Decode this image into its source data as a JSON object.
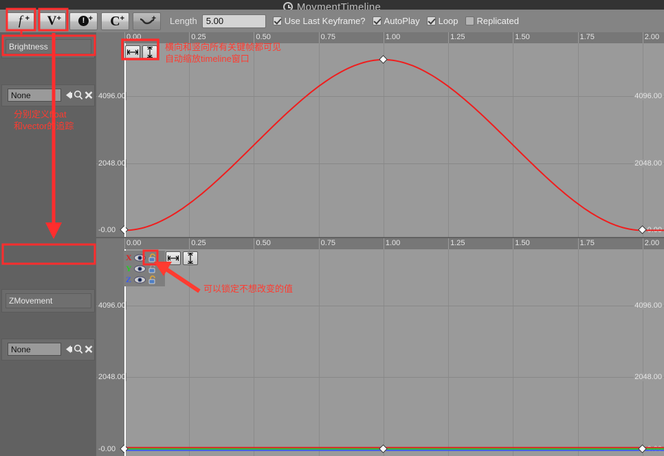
{
  "window": {
    "title": "MovmentTimeline",
    "icon": "clock-icon"
  },
  "toolbar": {
    "buttons": [
      {
        "name": "add-float-track",
        "glyph": "f",
        "plus": "+"
      },
      {
        "name": "add-vector-track",
        "glyph": "V",
        "plus": "+"
      },
      {
        "name": "add-event-track",
        "glyph": "!",
        "plus": "+"
      },
      {
        "name": "add-color-track",
        "glyph": "C",
        "plus": "+"
      },
      {
        "name": "add-curve-asset-track",
        "glyph": "curve",
        "plus": "+"
      }
    ],
    "length_label": "Length",
    "length_value": "5.00",
    "checkboxes": [
      {
        "label": "Use Last Keyframe?",
        "checked": true
      },
      {
        "label": "AutoPlay",
        "checked": true
      },
      {
        "label": "Loop",
        "checked": true
      },
      {
        "label": "Replicated",
        "checked": false
      }
    ]
  },
  "tracks": [
    {
      "name": "Brightness",
      "asset_value": "None",
      "asset_placeholder": "None",
      "type": "float",
      "curve_color": "#f01d1d"
    },
    {
      "name": "ZMovement",
      "asset_value": "None",
      "asset_placeholder": "None",
      "type": "vector",
      "axes": [
        {
          "label": "X",
          "color": "#e02020",
          "visible": true,
          "locked": false
        },
        {
          "label": "Y",
          "color": "#28c828",
          "visible": true,
          "locked": false
        },
        {
          "label": "Z",
          "color": "#3a5cf0",
          "visible": true,
          "locked": false
        }
      ]
    }
  ],
  "zoom_buttons": {
    "horizontal_label": "[↔]",
    "vertical_label": "↕",
    "horizontal_name": "zoom-to-fit-horizontal",
    "vertical_name": "zoom-to-fit-vertical"
  },
  "annotations": [
    {
      "id": "anno-toolbar",
      "text": "分别定义float\n和vector的追踪"
    },
    {
      "id": "anno-zoomfit",
      "text": "横向和竖向所有关键帧都可见\n自动缩放timeline窗口"
    },
    {
      "id": "anno-lock",
      "text": "可以锁定不想改变的值"
    }
  ],
  "chart_data": [
    {
      "type": "line",
      "name": "Brightness",
      "title": "Brightness",
      "xlabel": "",
      "ylabel": "",
      "xlim": [
        0.0,
        2.083
      ],
      "ylim": [
        -200,
        5700
      ],
      "xticks": [
        "0.00",
        "0.25",
        "0.50",
        "0.75",
        "1.00",
        "1.25",
        "1.50",
        "1.75",
        "2.00"
      ],
      "xtick_values": [
        0.0,
        0.25,
        0.5,
        0.75,
        1.0,
        1.25,
        1.5,
        1.75,
        2.0
      ],
      "yticks": [
        "4096.00",
        "2048.00",
        "-0.00"
      ],
      "ytick_values": [
        4096,
        2048,
        0
      ],
      "grid": true,
      "series": [
        {
          "name": "Brightness",
          "color": "#f01d1d",
          "keyframes": [
            {
              "x": 0.0,
              "y": 0
            },
            {
              "x": 1.0,
              "y": 5200
            },
            {
              "x": 2.0,
              "y": 0
            }
          ]
        }
      ]
    },
    {
      "type": "line",
      "name": "ZMovement",
      "title": "ZMovement",
      "xlabel": "",
      "ylabel": "",
      "xlim": [
        0.0,
        2.083
      ],
      "ylim": [
        -200,
        5700
      ],
      "xticks": [
        "0.00",
        "0.25",
        "0.50",
        "0.75",
        "1.00",
        "1.25",
        "1.50",
        "1.75",
        "2.00"
      ],
      "xtick_values": [
        0.0,
        0.25,
        0.5,
        0.75,
        1.0,
        1.25,
        1.5,
        1.75,
        2.0
      ],
      "yticks": [
        "4096.00",
        "2048.00",
        "-0.00"
      ],
      "ytick_values": [
        4096,
        2048,
        0
      ],
      "grid": true,
      "series": [
        {
          "name": "X",
          "color": "#e02020",
          "keyframes": [
            {
              "x": 0.0,
              "y": 0
            },
            {
              "x": 1.0,
              "y": 0
            },
            {
              "x": 2.0,
              "y": 0
            }
          ]
        },
        {
          "name": "Y",
          "color": "#28c828",
          "keyframes": [
            {
              "x": 0.0,
              "y": 0
            },
            {
              "x": 1.0,
              "y": 0
            },
            {
              "x": 2.0,
              "y": 0
            }
          ]
        },
        {
          "name": "Z",
          "color": "#3a5cf0",
          "keyframes": [
            {
              "x": 0.0,
              "y": 0
            },
            {
              "x": 1.0,
              "y": 0
            },
            {
              "x": 2.0,
              "y": 0
            }
          ]
        }
      ]
    }
  ],
  "colors": {
    "toolbar_bg": "#848484",
    "plot_bg": "#9a9a9a",
    "gutter_bg": "#777777",
    "annotation": "#ff3b30",
    "highlight": "#ff2d2d"
  }
}
